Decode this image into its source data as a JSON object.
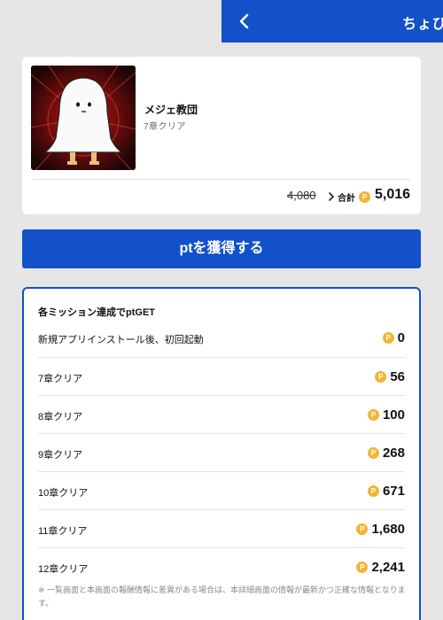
{
  "header": {
    "title": "ちょび",
    "back_icon": "chevron-left-icon"
  },
  "app": {
    "name": "メジェ教団",
    "subtitle": "7章クリア"
  },
  "points": {
    "old": "4,080",
    "total_label": "合計",
    "total": "5,016",
    "coin_glyph": "P"
  },
  "cta": {
    "label": "ptを獲得する"
  },
  "missions": {
    "title": "各ミッション達成でptGET",
    "items": [
      {
        "label": "新規アプリインストール後、初回起動",
        "value": "0"
      },
      {
        "label": "7章クリア",
        "value": "56"
      },
      {
        "label": "8章クリア",
        "value": "100"
      },
      {
        "label": "9章クリア",
        "value": "268"
      },
      {
        "label": "10章クリア",
        "value": "671"
      },
      {
        "label": "11章クリア",
        "value": "1,680"
      },
      {
        "label": "12章クリア",
        "value": "2,241"
      }
    ],
    "note": "※ 一覧画面と本画面の報酬情報に差異がある場合は、本詳細画面の情報が最新かつ正確な情報となります。"
  },
  "colors": {
    "brand": "#1251c9",
    "coin": "#f2b534",
    "background": "#e6e6e6"
  }
}
